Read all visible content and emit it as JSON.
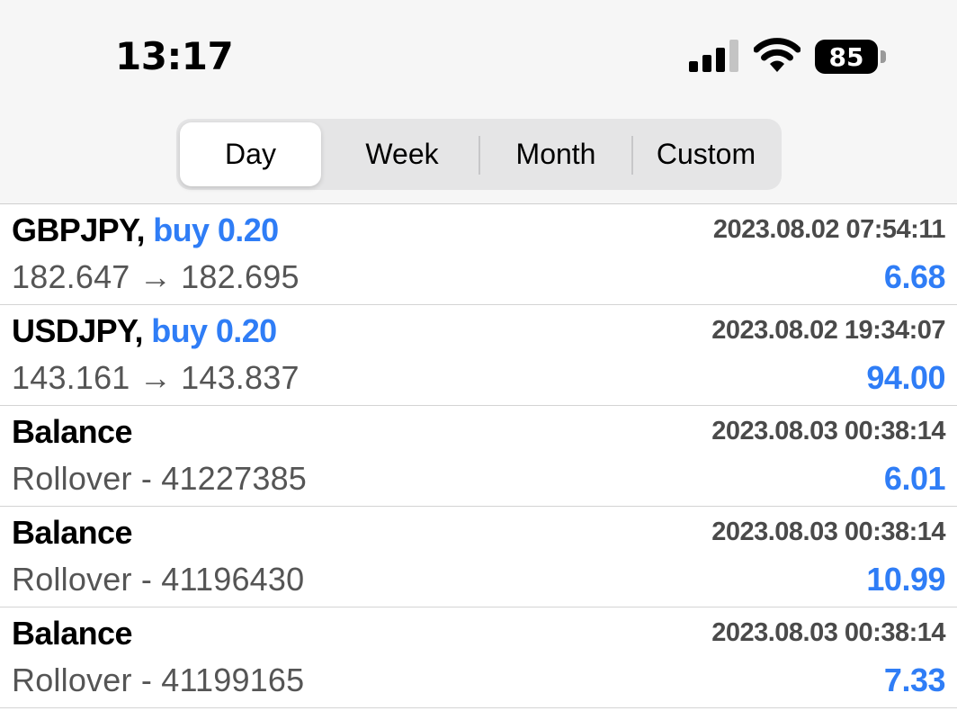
{
  "status_bar": {
    "time": "13:17",
    "battery_level": "85",
    "icons": [
      "cellular-signal-icon",
      "wifi-icon",
      "battery-icon"
    ]
  },
  "segmented": {
    "tabs": [
      {
        "label": "Day",
        "active": true
      },
      {
        "label": "Week",
        "active": false
      },
      {
        "label": "Month",
        "active": false
      },
      {
        "label": "Custom",
        "active": false
      }
    ]
  },
  "colors": {
    "accent": "#2f7df6",
    "secondary_text": "#555555",
    "date_text": "#4a4a4a"
  },
  "deals": [
    {
      "symbol": "GBPJPY,",
      "side": "buy 0.20",
      "time": "2023.08.02 07:54:11",
      "detail": "182.647 → 182.695",
      "profit": "6.68"
    },
    {
      "symbol": "USDJPY,",
      "side": "buy 0.20",
      "time": "2023.08.02 19:34:07",
      "detail": "143.161 → 143.837",
      "profit": "94.00"
    },
    {
      "symbol": "Balance",
      "side": "",
      "time": "2023.08.03 00:38:14",
      "detail": "Rollover - 41227385",
      "profit": "6.01"
    },
    {
      "symbol": "Balance",
      "side": "",
      "time": "2023.08.03 00:38:14",
      "detail": "Rollover - 41196430",
      "profit": "10.99"
    },
    {
      "symbol": "Balance",
      "side": "",
      "time": "2023.08.03 00:38:14",
      "detail": "Rollover - 41199165",
      "profit": "7.33"
    }
  ]
}
